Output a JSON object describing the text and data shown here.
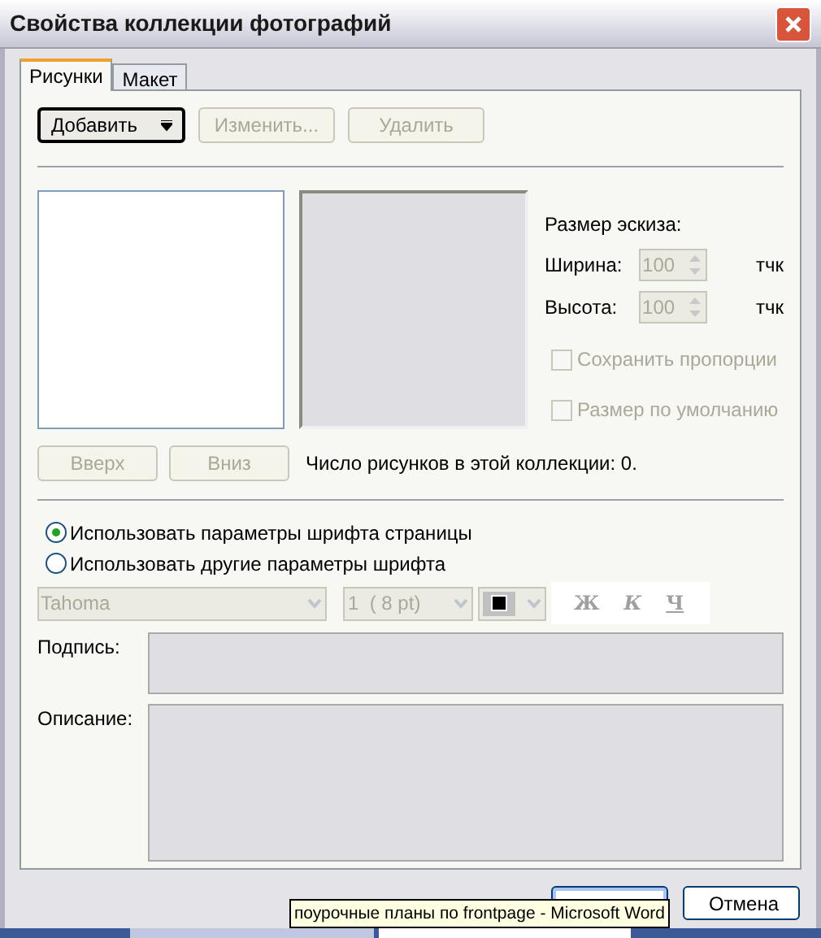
{
  "window": {
    "title": "Свойства коллекции фотографий"
  },
  "tabs": [
    {
      "label": "Рисунки",
      "selected": true
    },
    {
      "label": "Макет",
      "selected": false
    }
  ],
  "toolbar": [
    {
      "label": "Добавить",
      "kind": "menu",
      "disabled": false
    },
    {
      "label": "Изменить...",
      "kind": "plain",
      "disabled": true
    },
    {
      "label": "Удалить",
      "kind": "plain",
      "disabled": true
    }
  ],
  "thumbnail": {
    "title": "Размер эскиза:",
    "fields": [
      {
        "label": "Ширина:",
        "value": "100",
        "unit": "тчк",
        "disabled": true
      },
      {
        "label": "Высота:",
        "value": "100",
        "unit": "тчк",
        "disabled": true
      }
    ],
    "checkboxes": [
      {
        "label": "Сохранить пропорции",
        "checked": false,
        "disabled": true
      },
      {
        "label": "Размер по умолчанию",
        "checked": false,
        "disabled": true
      }
    ]
  },
  "order_buttons": [
    {
      "label": "Вверх",
      "disabled": true
    },
    {
      "label": "Вниз",
      "disabled": true
    }
  ],
  "count_text": "Число рисунков в этой коллекции: 0.",
  "font_options": [
    {
      "label": "Использовать параметры шрифта страницы",
      "selected": true
    },
    {
      "label": "Использовать другие параметры шрифта",
      "selected": false
    }
  ],
  "font_bar": {
    "font": "Tahoma",
    "size": "1  ( 8 pt)",
    "color": "#000000",
    "styles": [
      "Ж",
      "К",
      "Ч"
    ],
    "disabled": true
  },
  "caption": {
    "label": "Подпись:"
  },
  "description": {
    "label": "Описание:"
  },
  "dialog_buttons": [
    {
      "kind": "ok"
    },
    {
      "kind": "cancel",
      "label": "Отмена"
    }
  ],
  "tooltip": "поурочные планы по frontpage - Microsoft Word"
}
